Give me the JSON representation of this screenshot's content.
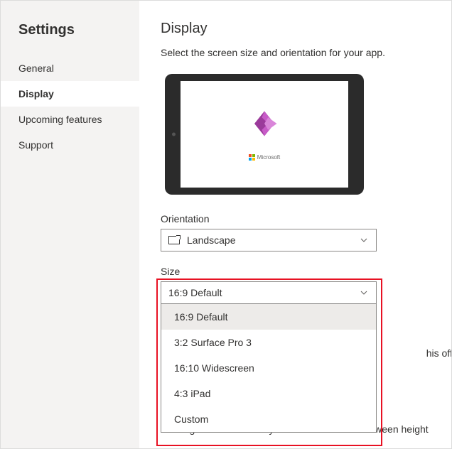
{
  "sidebar": {
    "title": "Settings",
    "items": [
      {
        "label": "General"
      },
      {
        "label": "Display"
      },
      {
        "label": "Upcoming features"
      },
      {
        "label": "Support"
      }
    ],
    "activeIndex": 1
  },
  "main": {
    "title": "Display",
    "subtitle": "Select the screen size and orientation for your app.",
    "preview_brand": "Microsoft",
    "orientation": {
      "label": "Orientation",
      "value": "Landscape"
    },
    "size": {
      "label": "Size",
      "value": "16:9 Default",
      "options": [
        "16:9 Default",
        "3:2 Surface Pro 3",
        "16:10 Widescreen",
        "4:3 iPad",
        "Custom"
      ],
      "selectedIndex": 0
    },
    "behind_text_1_suffix": "his off allows",
    "behind_text_2": "Locking this automatically maintains the ratio between height"
  }
}
